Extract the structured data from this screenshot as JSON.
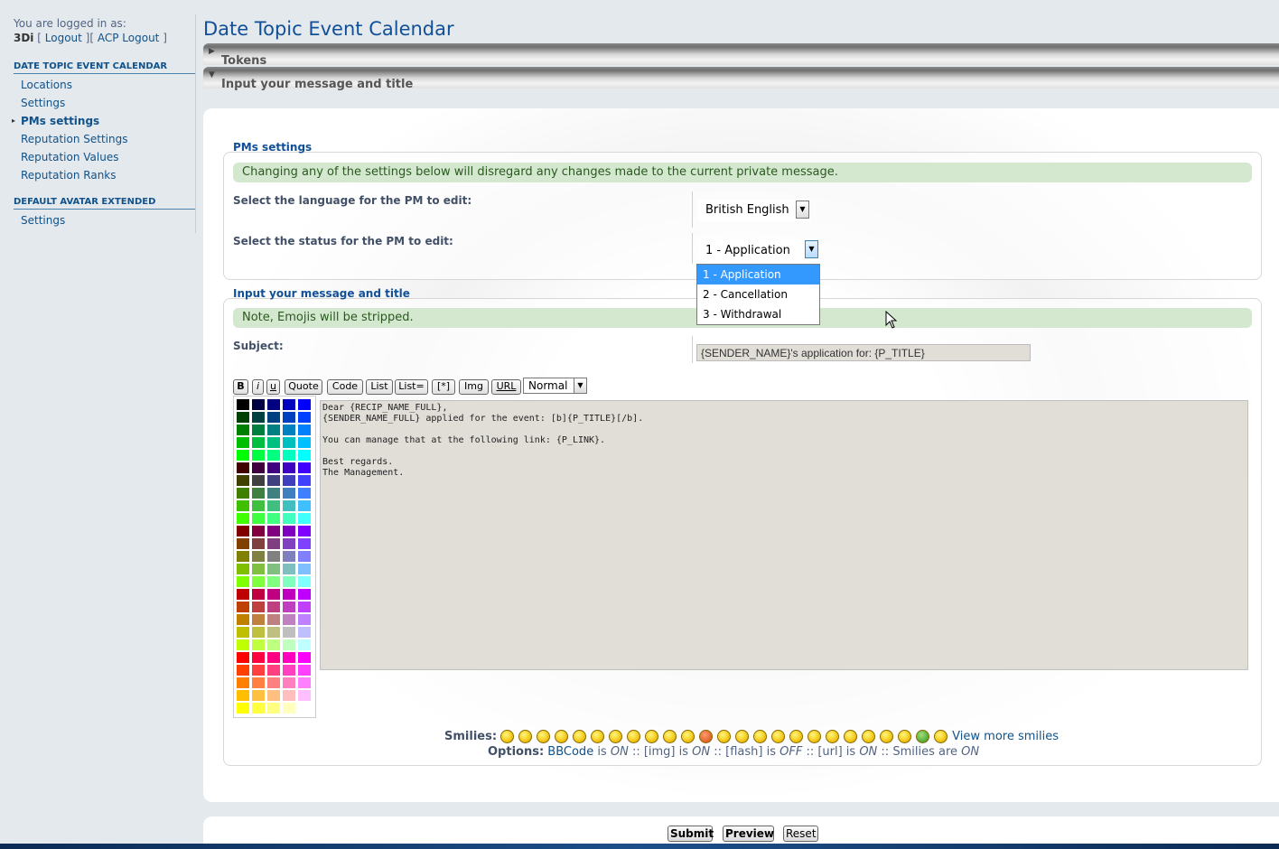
{
  "sidebar": {
    "logged_in_label": "You are logged in as:",
    "username": "3Di",
    "links": [
      "[ ",
      "Logout",
      " ][ ",
      "ACP Logout",
      " ]"
    ],
    "sections": [
      {
        "title": "DATE TOPIC EVENT CALENDAR",
        "items": [
          "Locations",
          "Settings",
          "PMs settings",
          "Reputation Settings",
          "Reputation Values",
          "Reputation Ranks"
        ]
      },
      {
        "title": "DEFAULT AVATAR EXTENDED",
        "items": [
          "Settings"
        ]
      }
    ],
    "active_item": "PMs settings"
  },
  "main": {
    "title": "Date Topic Event Calendar",
    "collapse_bars": [
      "Tokens",
      "Input your message and title"
    ]
  },
  "pms_settings": {
    "legend": "PMs settings",
    "notice": "Changing any of the settings below will disregard any changes made to the current private message.",
    "language_label": "Select the language for the PM to edit:",
    "language_value": "British English",
    "status_label": "Select the status for the PM to edit:",
    "status_value": "1 - Application",
    "status_options": [
      "1 - Application",
      "2 - Cancellation",
      "3 - Withdrawal"
    ]
  },
  "message": {
    "legend": "Input your message and title",
    "notice": "Note, Emojis will be stripped.",
    "subject_label": "Subject:",
    "subject_value": "{SENDER_NAME}'s application for: {P_TITLE}",
    "toolbar": [
      "B",
      "i",
      "u",
      "Quote",
      "Code",
      "List",
      "List=",
      "[*]",
      "Img",
      "URL"
    ],
    "font_size_value": "Normal",
    "body": "Dear {RECIP_NAME_FULL},\n{SENDER_NAME_FULL} applied for the event: [b]{P_TITLE}[/b].\n\nYou can manage that at the following link: {P_LINK}.\n\nBest regards.\nThe Management.",
    "smilies_label": "Smilies:",
    "view_more": "View more smilies",
    "options_label": "Options:",
    "options_parts": [
      "BBCode",
      " is ",
      "ON",
      " :: [img] is ",
      "ON",
      " :: [flash] is ",
      "OFF",
      " :: [url] is ",
      "ON",
      " :: Smilies are ",
      "ON"
    ]
  },
  "buttons": {
    "submit": "Submit",
    "preview": "Preview",
    "reset": "Reset"
  }
}
